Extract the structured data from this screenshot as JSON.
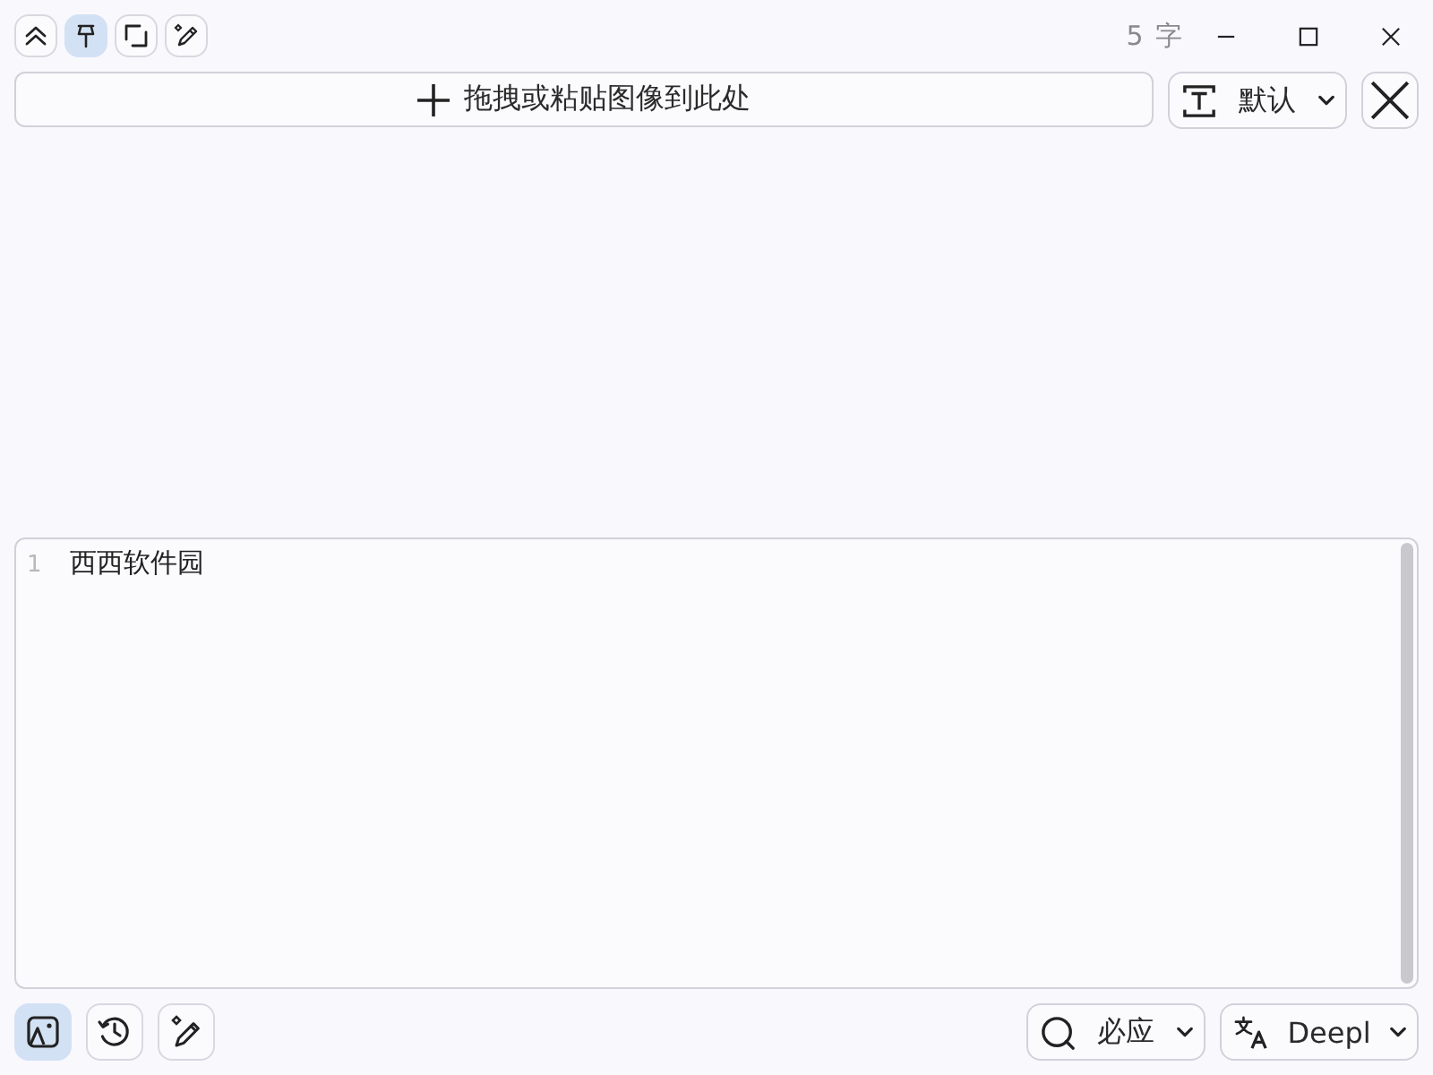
{
  "top_toolbar": [
    {
      "selected": false
    },
    {
      "selected": true
    },
    {
      "selected": false
    },
    {
      "selected": false
    }
  ],
  "char_count": "5 字",
  "drop_zone": {
    "label": "拖拽或粘贴图像到此处"
  },
  "ocr_mode": {
    "value": "默认"
  },
  "editor": {
    "lines": [
      {
        "number": "1",
        "text": "西西软件园"
      }
    ]
  },
  "bottom_toolbar": [
    {
      "selected": true
    },
    {
      "selected": false
    },
    {
      "selected": false
    }
  ],
  "search_engine": {
    "value": "必应"
  },
  "translator": {
    "value": "Deepl"
  }
}
